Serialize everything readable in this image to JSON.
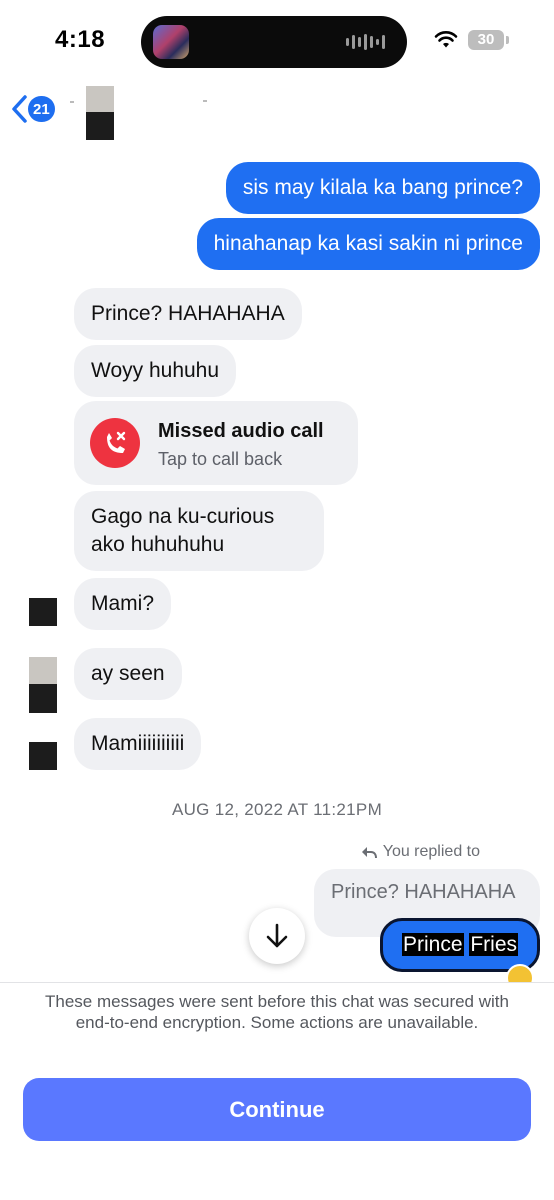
{
  "status_bar": {
    "time": "4:18",
    "battery": "30"
  },
  "header": {
    "unread_count": "21"
  },
  "messages": {
    "sent_1": "sis may kilala ka bang prince?",
    "sent_2": "hinahanap ka kasi sakin ni prince",
    "recv_1": "Prince? HAHAHAHA",
    "recv_2": "Woyy huhuhu",
    "call_title": "Missed audio call",
    "call_sub": "Tap to call back",
    "recv_3_line1": "Gago na ku-curious",
    "recv_3_line2": "ako huhuhuhu",
    "recv_4": "Mami?",
    "recv_5": "ay seen",
    "recv_6": "Mamiiiiiiiiii",
    "timestamp": "AUG 12, 2022 AT 11:21PM",
    "reply_label": "You replied to",
    "quoted_text": "Prince? HAHAHAHA",
    "reply_word_1": "Prince",
    "reply_word_2": "Fries"
  },
  "sheet": {
    "notice": "These messages were sent before this chat was secured with end-to-end encryption. Some actions are unavailable.",
    "continue_label": "Continue"
  },
  "colors": {
    "sent_bubble": "#1f6ff2",
    "received_bubble": "#eff0f3",
    "missed_call": "#ee3340",
    "continue_button": "#5a78ff"
  }
}
